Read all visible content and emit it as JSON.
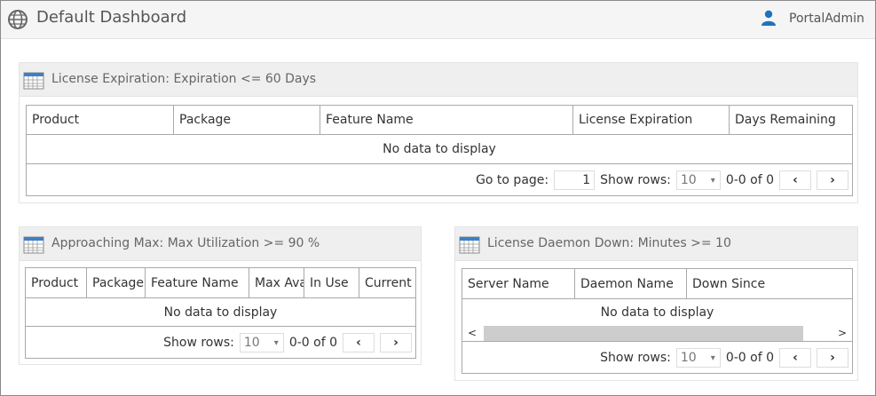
{
  "header": {
    "title": "Default Dashboard",
    "user": "PortalAdmin"
  },
  "panels": {
    "expiration": {
      "title": "License Expiration: Expiration <= 60 Days",
      "columns": [
        "Product",
        "Package",
        "Feature Name",
        "License Expiration",
        "Days Remaining"
      ],
      "empty": "No data to display",
      "goto_label": "Go to page:",
      "page": "1",
      "rows_label": "Show rows:",
      "rows": "10",
      "range": "0-0 of 0"
    },
    "maxutil": {
      "title": "Approaching Max: Max Utilization >= 90 %",
      "columns": [
        "Product",
        "Package",
        "Feature Name",
        "Max Available",
        "In Use",
        "Current"
      ],
      "empty": "No data to display",
      "rows_label": "Show rows:",
      "rows": "10",
      "range": "0-0 of 0"
    },
    "daemon": {
      "title": "License Daemon Down: Minutes >= 10",
      "columns": [
        "Server Name",
        "Daemon Name",
        "Down Since"
      ],
      "empty": "No data to display",
      "rows_label": "Show rows:",
      "rows": "10",
      "range": "0-0 of 0"
    }
  },
  "icons": {
    "prev": "‹",
    "next": "›",
    "scroll_left": "<",
    "scroll_right": ">",
    "dropdown": "▾"
  }
}
